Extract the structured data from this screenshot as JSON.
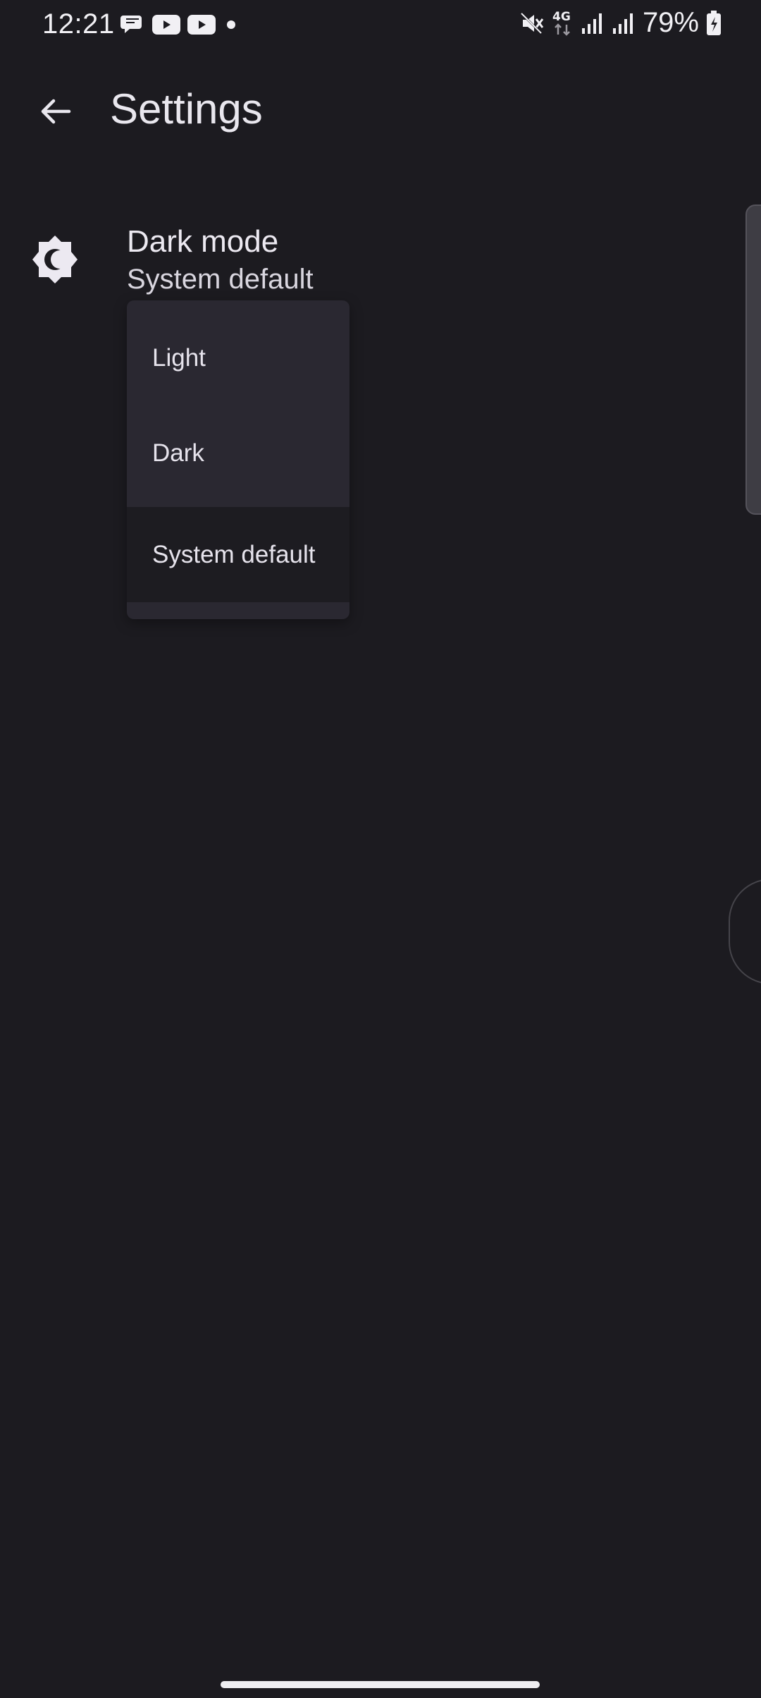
{
  "status_bar": {
    "time": "12:21",
    "battery_percent": "79%",
    "network_label": "4G",
    "icons": [
      "chat-icon",
      "youtube-icon",
      "youtube-icon",
      "notification-dot-icon",
      "mute-icon",
      "network-4g-icon",
      "signal-icon",
      "signal-icon",
      "battery-charging-icon"
    ]
  },
  "app_bar": {
    "title": "Settings",
    "back_icon": "back-arrow-icon"
  },
  "setting": {
    "icon": "dark-mode-icon",
    "title": "Dark mode",
    "value": "System default"
  },
  "dropdown": {
    "items": [
      {
        "label": "Light",
        "selected": false
      },
      {
        "label": "Dark",
        "selected": false
      },
      {
        "label": "System default",
        "selected": true
      }
    ]
  },
  "colors": {
    "background": "#1c1b20",
    "menu_background": "#2a2831",
    "menu_selected": "#1d1c21",
    "text_primary": "#e9e7ee"
  }
}
